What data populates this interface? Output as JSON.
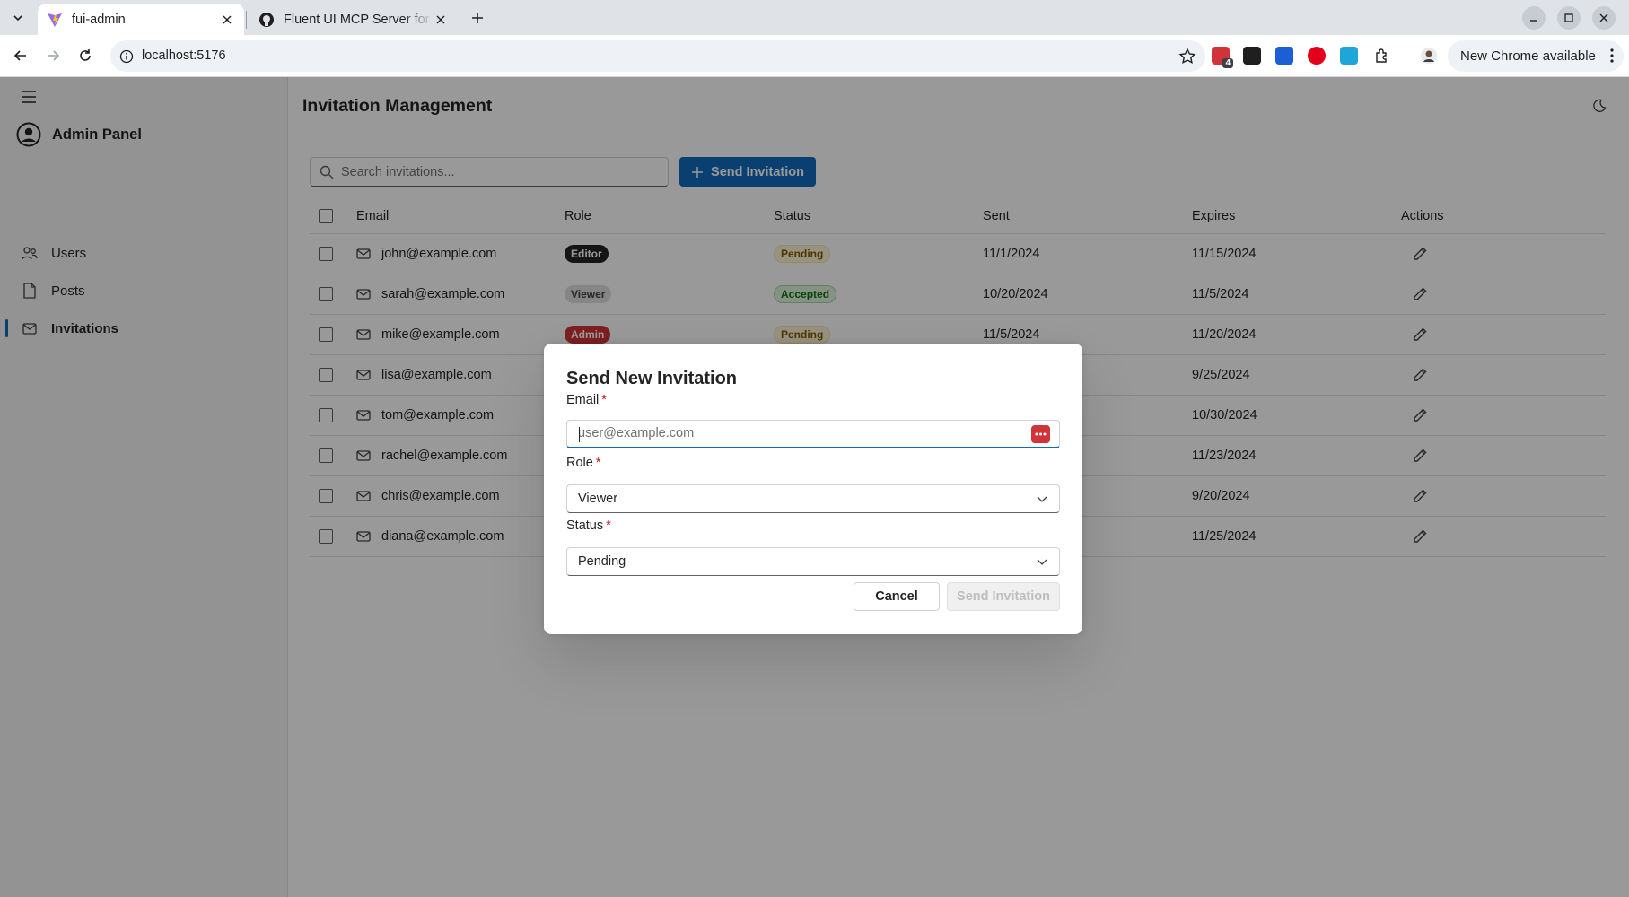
{
  "browser": {
    "tabs": [
      {
        "title": "fui-admin",
        "active": true
      },
      {
        "title": "Fluent UI MCP Server for",
        "active": false
      }
    ],
    "url": "localhost:5176",
    "extension_badge": "4",
    "update_label": "New Chrome available"
  },
  "app": {
    "brand": "Admin Panel",
    "nav": [
      {
        "label": "Users",
        "icon": "people-icon"
      },
      {
        "label": "Posts",
        "icon": "document-icon"
      },
      {
        "label": "Invitations",
        "icon": "mail-icon",
        "selected": true
      }
    ],
    "page_title": "Invitation Management",
    "search_placeholder": "Search invitations...",
    "send_button": "Send Invitation",
    "columns": [
      "Email",
      "Role",
      "Status",
      "Sent",
      "Expires",
      "Actions"
    ],
    "rows": [
      {
        "email": "john@example.com",
        "role": "Editor",
        "status": "Pending",
        "sent": "11/1/2024",
        "expires": "11/15/2024"
      },
      {
        "email": "sarah@example.com",
        "role": "Viewer",
        "status": "Accepted",
        "sent": "10/20/2024",
        "expires": "11/5/2024"
      },
      {
        "email": "mike@example.com",
        "role": "Admin",
        "status": "Pending",
        "sent": "11/5/2024",
        "expires": "11/20/2024"
      },
      {
        "email": "lisa@example.com",
        "role": "",
        "status": "",
        "sent": "",
        "expires": "9/25/2024"
      },
      {
        "email": "tom@example.com",
        "role": "",
        "status": "",
        "sent": "",
        "expires": "10/30/2024"
      },
      {
        "email": "rachel@example.com",
        "role": "",
        "status": "",
        "sent": "",
        "expires": "11/23/2024"
      },
      {
        "email": "chris@example.com",
        "role": "",
        "status": "",
        "sent": "",
        "expires": "9/20/2024"
      },
      {
        "email": "diana@example.com",
        "role": "",
        "status": "",
        "sent": "",
        "expires": "11/25/2024"
      }
    ]
  },
  "dialog": {
    "title": "Send New Invitation",
    "email_label": "Email",
    "email_placeholder": "user@example.com",
    "email_value": "",
    "role_label": "Role",
    "role_value": "Viewer",
    "status_label": "Status",
    "status_value": "Pending",
    "required_mark": "*",
    "cancel": "Cancel",
    "submit": "Send Invitation"
  },
  "colors": {
    "brand": "#0f6cbd",
    "admin_badge": "#d13438",
    "editor_badge": "#242424",
    "pending_badge": "#fdf3d6",
    "accepted_badge": "#dff6dd"
  }
}
